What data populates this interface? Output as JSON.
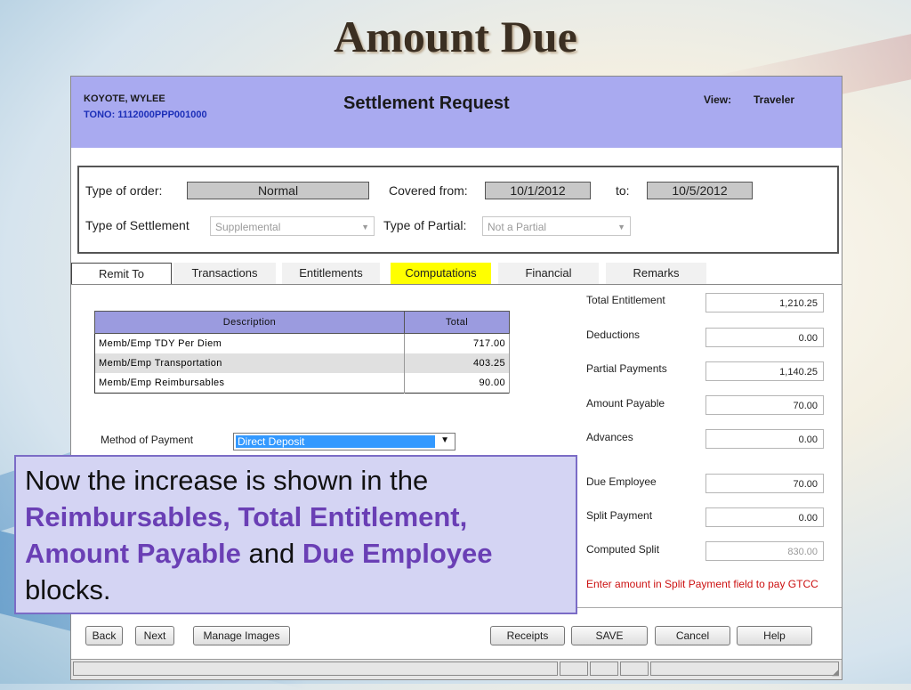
{
  "slide_title": "Amount Due",
  "header": {
    "name": "KOYOTE, WYLEE",
    "tono": "TONO: 1112000PPP001000",
    "title": "Settlement Request",
    "view_label": "View:",
    "view_value": "Traveler",
    "bg_color": "#a9aaf0"
  },
  "order": {
    "type_of_order_label": "Type of order:",
    "type_of_order_value": "Normal",
    "covered_from_label": "Covered from:",
    "covered_from_value": "10/1/2012",
    "to_label": "to:",
    "to_value": "10/5/2012",
    "type_of_settlement_label": "Type of Settlement",
    "type_of_settlement_value": "Supplemental",
    "type_of_partial_label": "Type of Partial:",
    "type_of_partial_value": "Not a Partial"
  },
  "tabs": [
    {
      "label": "Remit To",
      "active": true
    },
    {
      "label": "Transactions"
    },
    {
      "label": "Entitlements"
    },
    {
      "label": "Computations",
      "highlight": "#ffff00"
    },
    {
      "label": "Financial"
    },
    {
      "label": "Remarks"
    }
  ],
  "computations": {
    "headers": [
      "Description",
      "Total"
    ],
    "rows": [
      {
        "description": "Memb/Emp TDY Per Diem",
        "total": "717.00"
      },
      {
        "description": "Memb/Emp Transportation",
        "total": "403.25"
      },
      {
        "description": "Memb/Emp Reimbursables",
        "total": "90.00"
      }
    ]
  },
  "method_of_payment": {
    "label": "Method of Payment",
    "value": "Direct Deposit"
  },
  "summary": [
    {
      "label": "Total Entitlement",
      "value": "1,210.25"
    },
    {
      "label": "Deductions",
      "value": "0.00"
    },
    {
      "label": "Partial Payments",
      "value": "1,140.25"
    },
    {
      "label": "Amount Payable",
      "value": "70.00"
    },
    {
      "label": "Advances",
      "value": "0.00"
    },
    {
      "label": "Due Employee",
      "value": "70.00"
    },
    {
      "label": "Split Payment",
      "value": "0.00"
    },
    {
      "label": "Computed Split",
      "value": "830.00",
      "disabled": true
    }
  ],
  "split_note": "Enter amount in Split Payment field to pay GTCC",
  "buttons": {
    "back": "Back",
    "next": "Next",
    "manage_images": "Manage Images",
    "receipts": "Receipts",
    "save": "SAVE",
    "cancel": "Cancel",
    "help": "Help"
  },
  "callout": {
    "t1": "Now the increase is shown in the",
    "e1": "Reimbursables, Total Entitlement, Amount Payable",
    "t2": "and",
    "e2": "Due Employee",
    "t3": "blocks.",
    "emphasis_color": "#6a3fb5"
  }
}
